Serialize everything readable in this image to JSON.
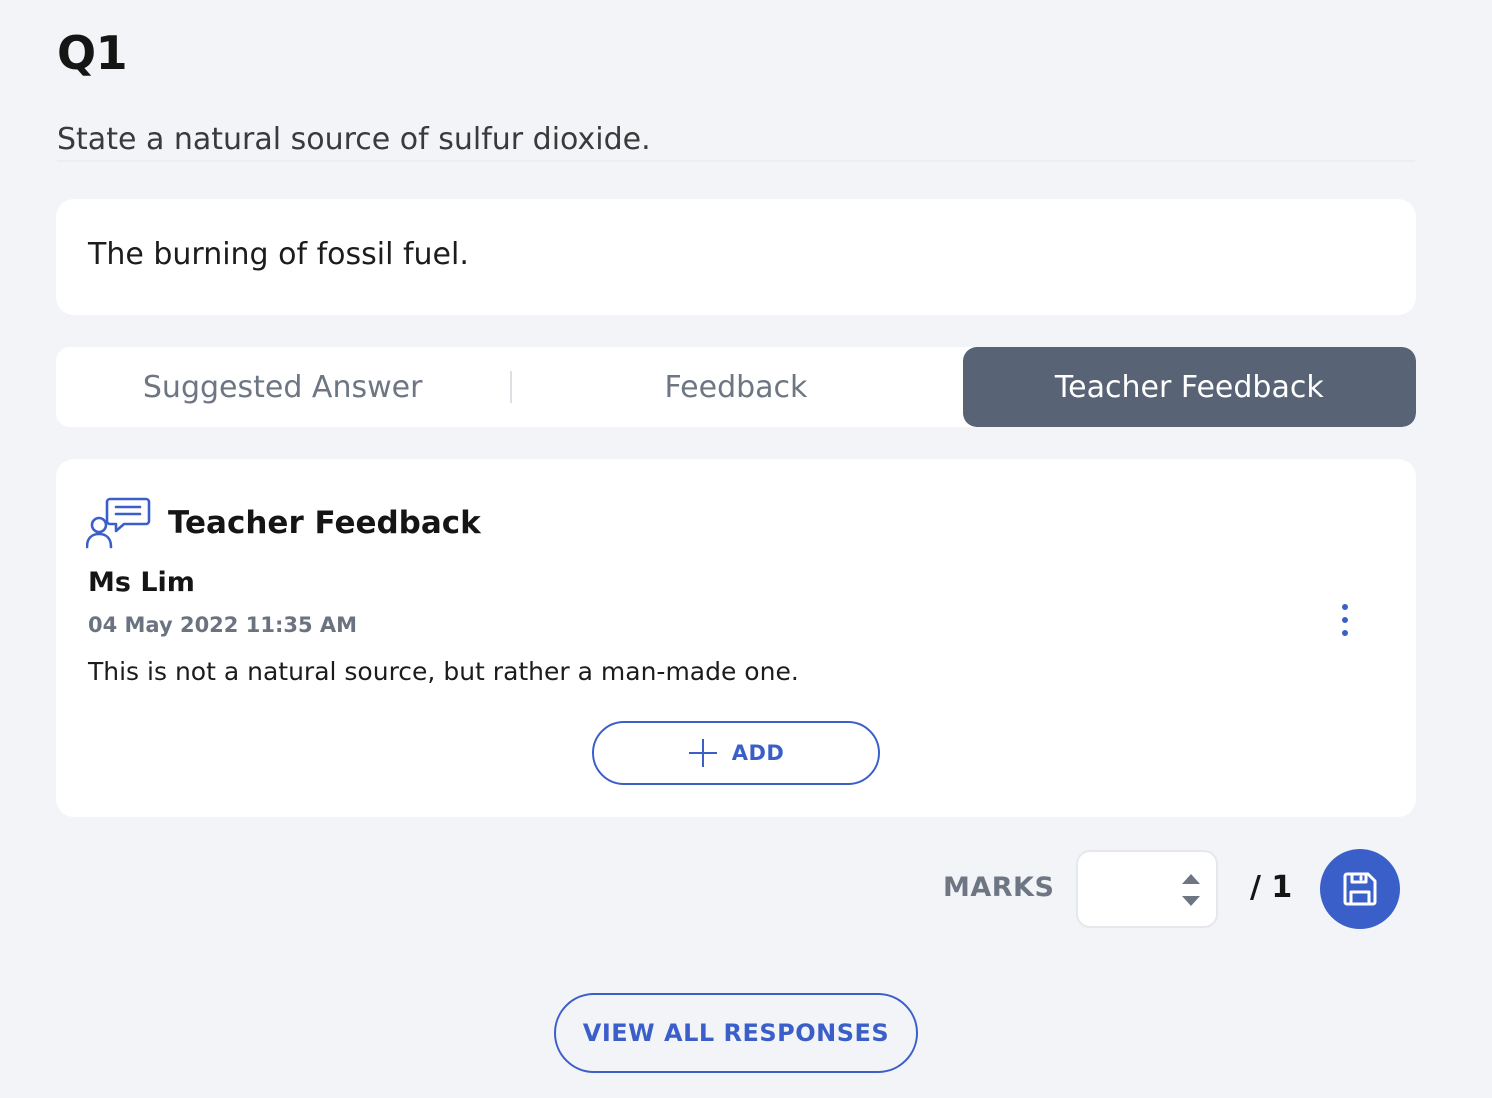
{
  "question": {
    "number": "Q1",
    "text": "State a natural source of sulfur dioxide."
  },
  "answer": {
    "text": "The burning of fossil fuel."
  },
  "tabs": [
    {
      "label": "Suggested Answer",
      "active": false
    },
    {
      "label": "Feedback",
      "active": false
    },
    {
      "label": "Teacher Feedback",
      "active": true
    }
  ],
  "teacher_feedback": {
    "heading": "Teacher Feedback",
    "icon": "chat-person-icon",
    "entry": {
      "author": "Ms Lim",
      "date": "04 May 2022 11:35 AM",
      "text": "This is not a natural source, but rather a man-made one."
    },
    "add_label": "ADD"
  },
  "marks": {
    "label": "MARKS",
    "value": "",
    "total": "/ 1"
  },
  "view_all_label": "VIEW ALL RESPONSES",
  "colors": {
    "accent": "#3b5fc9",
    "active_tab": "#586476",
    "background": "#f3f4f8"
  }
}
